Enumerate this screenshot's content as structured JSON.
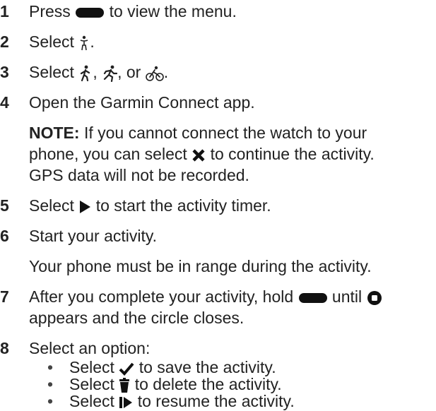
{
  "steps": [
    {
      "num": "1",
      "a": "Press",
      "b": "to view the menu."
    },
    {
      "num": "2",
      "a": "Select",
      "b": "."
    },
    {
      "num": "3",
      "a": "Select",
      "b": ",",
      "c": ", or",
      "d": "."
    },
    {
      "num": "4",
      "text": "Open the Garmin Connect app."
    },
    {
      "num": "5",
      "a": "Select",
      "b": "to start the activity timer."
    },
    {
      "num": "6",
      "text": "Start your activity."
    },
    {
      "num": "7",
      "a": "After you complete your activity, hold",
      "b": "until",
      "c": "appears and the circle closes."
    },
    {
      "num": "8",
      "text": "Select an option:"
    }
  ],
  "note": {
    "label": "NOTE:",
    "l1": "If you cannot connect the watch to your",
    "l2a": "phone, you can select",
    "l2b": "to continue the activity.",
    "l3": "GPS data will not be recorded."
  },
  "step6_detail": "Your phone must be in range during the activity.",
  "options": [
    {
      "bullet": "•",
      "a": "Select",
      "b": "to save the activity."
    },
    {
      "bullet": "•",
      "a": "Select",
      "b": "to delete the activity."
    },
    {
      "bullet": "•",
      "a": "Select",
      "b": "to resume the activity."
    }
  ],
  "icons": {
    "button": "button-icon",
    "activity": "person-standing-icon",
    "walk": "walk-icon",
    "run": "run-icon",
    "bike": "bike-icon",
    "cancel": "x-icon",
    "start": "play-icon",
    "stop": "stop-icon",
    "save": "checkmark-icon",
    "delete": "trash-icon",
    "resume": "resume-icon"
  }
}
